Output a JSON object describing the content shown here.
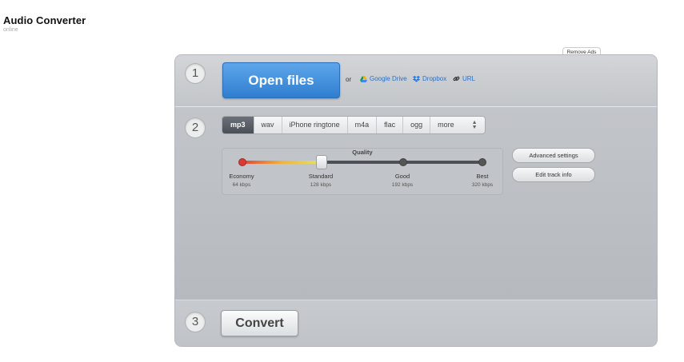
{
  "app": {
    "title": "Audio Converter",
    "subtitle": "online"
  },
  "header": {
    "remove_ads": "Remove Ads"
  },
  "step1": {
    "number": "1",
    "open_label": "Open files",
    "or_label": "or",
    "sources": [
      {
        "label": "Google Drive",
        "icon": "google-drive-icon"
      },
      {
        "label": "Dropbox",
        "icon": "dropbox-icon"
      },
      {
        "label": "URL",
        "icon": "link-icon"
      }
    ]
  },
  "step2": {
    "number": "2",
    "formats": [
      "mp3",
      "wav",
      "iPhone ringtone",
      "m4a",
      "flac",
      "ogg",
      "more"
    ],
    "selected_format": "mp3",
    "quality": {
      "title": "Quality",
      "selected_index": 1,
      "stops": [
        {
          "label": "Economy",
          "rate": "64 kbps"
        },
        {
          "label": "Standard",
          "rate": "128 kbps"
        },
        {
          "label": "Good",
          "rate": "192 kbps"
        },
        {
          "label": "Best",
          "rate": "320 kbps"
        }
      ]
    },
    "buttons": {
      "advanced": "Advanced settings",
      "edit": "Edit track info"
    }
  },
  "step3": {
    "number": "3",
    "convert_label": "Convert"
  },
  "colors": {
    "accent": "#2f7ed0",
    "link": "#2a6fc4"
  }
}
